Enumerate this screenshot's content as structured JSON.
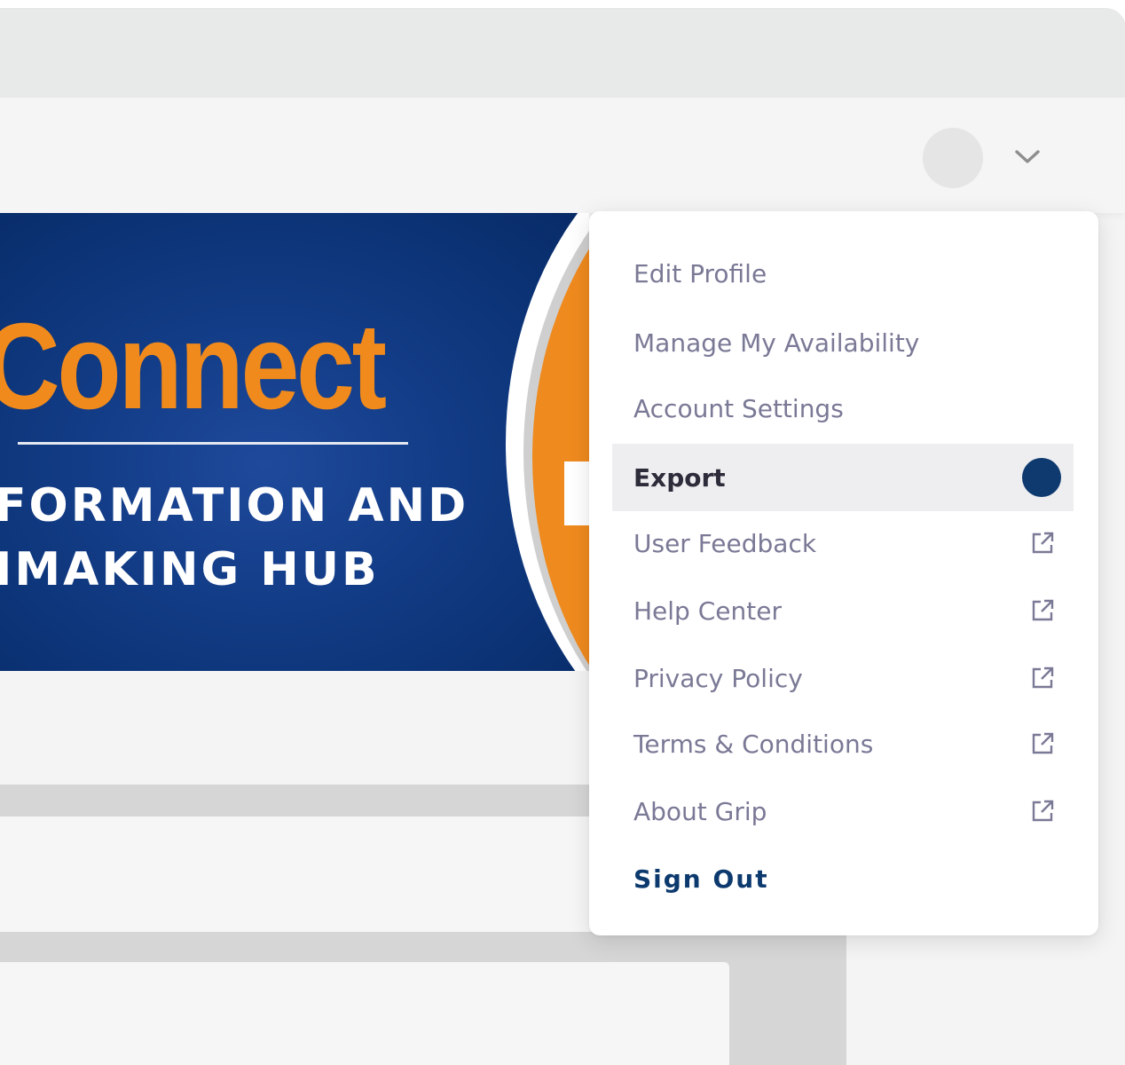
{
  "banner": {
    "title": "Connect",
    "line1": "FORMATION AND",
    "line2": "IMAKING HUB"
  },
  "header": {
    "avatar_icon": "avatar",
    "menu_toggle_icon": "chevron-down-icon"
  },
  "menu": {
    "items": [
      {
        "label": "Edit Profile"
      },
      {
        "label": "Manage My Availability"
      },
      {
        "label": "Account Settings"
      },
      {
        "label": "Export",
        "active": true,
        "indicator": "status-dot",
        "indicator_color": "#0e3a6f"
      },
      {
        "label": "User Feedback",
        "icon": "external-link-icon"
      },
      {
        "label": "Help Center",
        "icon": "external-link-icon"
      },
      {
        "label": "Privacy Policy",
        "icon": "external-link-icon"
      },
      {
        "label": "Terms & Conditions",
        "icon": "external-link-icon"
      },
      {
        "label": "About Grip",
        "icon": "external-link-icon"
      }
    ],
    "sign_out": "Sign Out"
  },
  "colors": {
    "accent": "#0d3a6e",
    "banner_orange": "#f08a1c",
    "banner_blue": "#123c86",
    "menu_text": "#7a7996"
  }
}
